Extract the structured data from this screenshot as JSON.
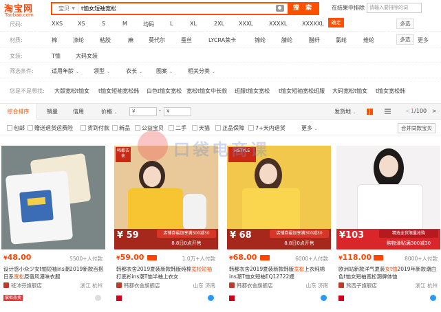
{
  "logo": {
    "cn": "淘宝网",
    "en": "Taobao.com"
  },
  "search": {
    "scope": "宝贝",
    "query": "t恤女短袖宽松",
    "button": "搜 索",
    "exclude_label": "在结果中排除",
    "exclude_placeholder": "请输入要排除的词"
  },
  "filters": {
    "size": {
      "label": "尺码:",
      "options": [
        "XXS",
        "XS",
        "S",
        "M",
        "均码",
        "L",
        "XL",
        "2XL",
        "XXXL",
        "XXXXL",
        "XXXXXL"
      ],
      "confirm": "确定",
      "multi": "多选"
    },
    "material": {
      "label": "材质:",
      "options": [
        "棉",
        "涤纶",
        "粘胶",
        "麻",
        "莫代尔",
        "蚕丝",
        "LYCRA莱卡",
        "锦纶",
        "腈纶",
        "醋纤",
        "氯纶",
        "维纶"
      ],
      "multi": "多选",
      "more": "更多"
    },
    "style": {
      "label": "女装:",
      "options": [
        "T恤",
        "大码女装"
      ]
    },
    "conditions": {
      "label": "筛选条件:",
      "dropdowns": [
        "适用年龄",
        "领型",
        "衣长",
        "图案",
        "相关分类"
      ]
    },
    "suggest": {
      "label": "您是不是想找:",
      "options": [
        "大版宽松t恤女",
        "t恤女短袖宽松韩",
        "白色t恤女宽松",
        "宽松t恤女中长款",
        "班服t恤女宽松",
        "t恤女短袖宽松班服",
        "大码宽松t恤女",
        "t恤女宽松韩"
      ]
    }
  },
  "sortbar": {
    "default": "综合排序",
    "sales": "销量",
    "credit": "信用",
    "price": "价格",
    "price_from": "¥",
    "price_to": "¥",
    "ship_from": "发货地",
    "page_current": "1",
    "page_total": "/100",
    "prev": "<",
    "next": ">"
  },
  "checkbar": {
    "items": [
      "包邮",
      "赠送退货运费险",
      "货到付款",
      "新品",
      "公益宝贝",
      "二手",
      "天猫",
      "正品保障",
      "7+天内退货"
    ],
    "more": "更多",
    "combine": "合并同款宝贝"
  },
  "products": [
    {
      "price": "48.00",
      "sales": "5500+人付款",
      "title_pre": "设计感小众少女t恤短袖ins潮2019新款百搭日系",
      "title_em": "宽松",
      "title_post": "原宿风港味衣服",
      "shop": "班沛芬旗舰店",
      "location": "浙江 杭州",
      "badge": "掌柜热卖"
    },
    {
      "price": "59.00",
      "sales": "1.0万+人付款",
      "title_pre": "韩都衣舍2019夏装新款韩版纯棉",
      "title_em": "宽松短袖",
      "title_post": "打底衫ins潮T恤半袖上衣女",
      "shop": "韩都衣舍旗舰店",
      "location": "山东 济南",
      "promo_price": "¥ 59",
      "promo_tag": "店铺券最加享满300减30",
      "promo_sub": "8.8日0点开售",
      "corner": "韩都衣舍"
    },
    {
      "price": "68.00",
      "sales": "6000+人付款",
      "title_pre": "韩都衣舍2019夏装新款韩版",
      "title_em": "宽松",
      "title_post": "上衣纯棉ins潮T恤女短袖EQ12722媤",
      "shop": "韩都衣舍旗舰店",
      "location": "山东 济南",
      "promo_price": "¥ 68",
      "promo_tag": "店铺券最加享满300减30",
      "promo_sub": "8.8日0点开售",
      "corner": "HSTYLE"
    },
    {
      "price": "118.00",
      "sales": "8000+人付款",
      "title_pre": "欧洲站新款洋气夏装",
      "title_em": "女t恤",
      "title_post": "2019年新款潮白色t恤女短袖宽松潮牌体恤",
      "shop": "熊西子旗舰店",
      "location": "浙江 杭州",
      "promo_price": "¥103",
      "promo_tag": "精选全货限量抢购",
      "promo_sub": "购物津贴满300减30"
    }
  ],
  "watermark": {
    "text": "口袋电商课"
  },
  "colors": {
    "accent": "#ff5000",
    "price": "#ff4400"
  }
}
